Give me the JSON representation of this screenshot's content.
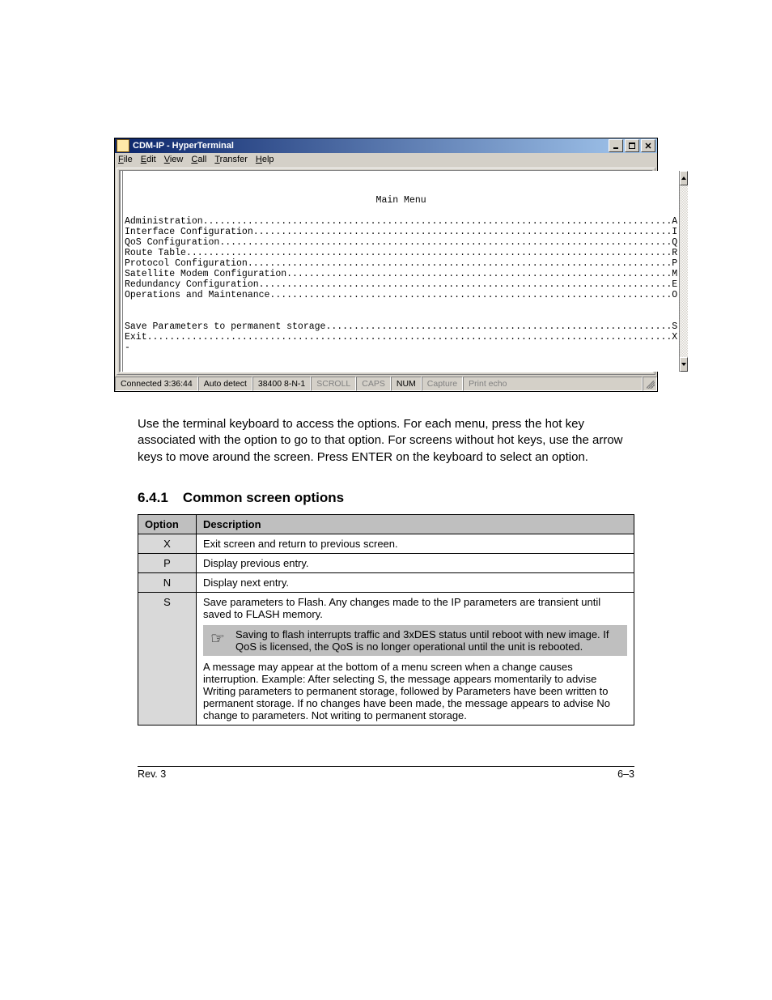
{
  "window": {
    "title": "CDM-IP - HyperTerminal",
    "menus": [
      "File",
      "Edit",
      "View",
      "Call",
      "Transfer",
      "Help"
    ]
  },
  "terminal": {
    "header": "Main Menu",
    "items": [
      {
        "label": "Administration",
        "key": "A"
      },
      {
        "label": "Interface Configuration",
        "key": "I"
      },
      {
        "label": "QoS Configuration",
        "key": "Q"
      },
      {
        "label": "Route Table",
        "key": "R"
      },
      {
        "label": "Protocol Configuration",
        "key": "P"
      },
      {
        "label": "Satellite Modem Configuration",
        "key": "M"
      },
      {
        "label": "Redundancy Configuration",
        "key": "E"
      },
      {
        "label": "Operations and Maintenance",
        "key": "O"
      }
    ],
    "extra": [
      {
        "label": "Save Parameters to permanent storage",
        "key": "S"
      },
      {
        "label": "Exit",
        "key": "X"
      }
    ],
    "prompt": "-"
  },
  "statusbar": {
    "connected": "Connected 3:36:44",
    "auto": "Auto detect",
    "linecfg": "38400 8-N-1",
    "scroll": "SCROLL",
    "caps": "CAPS",
    "num": "NUM",
    "capture": "Capture",
    "printecho": "Print echo"
  },
  "body": {
    "paragraph": "Use the terminal keyboard to access the options. For each menu, press the hot key associated with the option to go to that option. For screens without hot keys, use the arrow keys to move around the screen. Press ENTER on the keyboard to select an option.",
    "subhead_num": "6.4.1",
    "subhead_text": "Common screen options"
  },
  "table": {
    "headers": [
      "Option",
      "Description"
    ],
    "rows": [
      {
        "key": "X",
        "desc": "Exit screen and return to previous screen."
      },
      {
        "key": "P",
        "desc": "Display previous entry."
      },
      {
        "key": "N",
        "desc": "Display next entry."
      },
      {
        "key": "S",
        "desc_intro": "Save parameters to Flash. Any changes made to the IP parameters are transient until saved to FLASH memory.",
        "note": "Saving to flash interrupts traffic and 3xDES status until reboot with new image. If QoS is licensed, the QoS is no longer operational until the unit is rebooted.",
        "desc_outro": "A message may appear at the bottom of a menu screen when a change causes interruption. Example: After selecting S, the message appears momentarily to advise Writing parameters to permanent storage, followed by Parameters have been written to permanent storage. If no changes have been made, the message appears to advise No change to parameters. Not writing to permanent storage."
      }
    ]
  },
  "footer": {
    "left": "Rev. 3",
    "right": "6–3"
  }
}
